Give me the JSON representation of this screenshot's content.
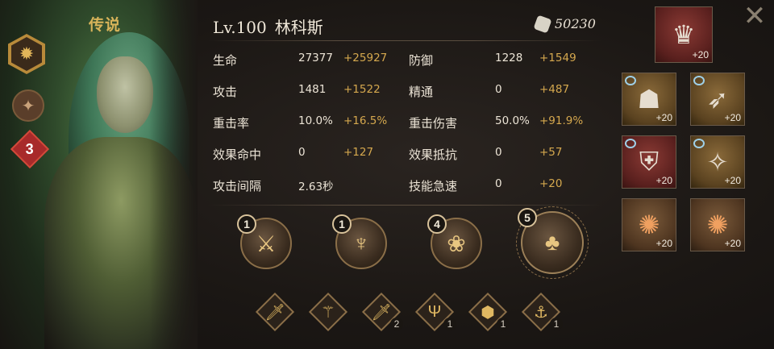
{
  "header": {
    "rarity": "传说",
    "level": "Lv.100",
    "name": "林科斯",
    "power": "50230"
  },
  "side_badges": [
    {
      "icon": "sun-star-icon"
    },
    {
      "icon": "compass-icon"
    },
    {
      "icon": "diamond-number-icon",
      "value": "3"
    }
  ],
  "stats": {
    "rows": [
      {
        "left": {
          "label": "生命",
          "value": "27377",
          "bonus": "+25927"
        },
        "right": {
          "label": "防御",
          "value": "1228",
          "bonus": "+1549"
        }
      },
      {
        "left": {
          "label": "攻击",
          "value": "1481",
          "bonus": "+1522"
        },
        "right": {
          "label": "精通",
          "value": "0",
          "bonus": "+487"
        }
      },
      {
        "left": {
          "label": "重击率",
          "value": "10.0%",
          "bonus": "+16.5%"
        },
        "right": {
          "label": "重击伤害",
          "value": "50.0%",
          "bonus": "+91.9%"
        }
      },
      {
        "left": {
          "label": "效果命中",
          "value": "0",
          "bonus": "+127"
        },
        "right": {
          "label": "效果抵抗",
          "value": "0",
          "bonus": "+57"
        }
      },
      {
        "left": {
          "label": "攻击间隔",
          "value": "2.63秒",
          "bonus": ""
        },
        "right": {
          "label": "技能急速",
          "value": "0",
          "bonus": "+20"
        }
      }
    ]
  },
  "skills": [
    {
      "level": "1",
      "icon": "crossed-swords-icon"
    },
    {
      "level": "1",
      "icon": "druid-figure-icon"
    },
    {
      "level": "4",
      "icon": "flower-orb-icon"
    },
    {
      "level": "5",
      "icon": "forest-spirit-icon"
    }
  ],
  "runes": [
    {
      "icon": "sword-icon",
      "count": ""
    },
    {
      "icon": "sword-pedestal-icon",
      "count": ""
    },
    {
      "icon": "sword-icon",
      "count": "2"
    },
    {
      "icon": "trident-icon",
      "count": "1"
    },
    {
      "icon": "shield-emblem-icon",
      "count": "1"
    },
    {
      "icon": "anchor-icon",
      "count": "1"
    }
  ],
  "equipment": [
    {
      "slot": "crown",
      "plus": "+20",
      "icon": "golden-crown-icon",
      "rarity": "red"
    },
    {
      "slot": "cloak",
      "plus": "+20",
      "icon": "dark-cloak-icon",
      "rarity": "gold"
    },
    {
      "slot": "spear",
      "plus": "+20",
      "icon": "ice-spear-icon",
      "rarity": "gold"
    },
    {
      "slot": "armor",
      "plus": "+20",
      "icon": "dark-armor-icon",
      "rarity": "red"
    },
    {
      "slot": "gauntlet",
      "plus": "+20",
      "icon": "crystal-gauntlet-icon",
      "rarity": "gold"
    },
    {
      "slot": "gem-1",
      "plus": "+20",
      "icon": "fire-gem-icon",
      "rarity": "warm"
    },
    {
      "slot": "gem-2",
      "plus": "+20",
      "icon": "fire-gem-icon",
      "rarity": "warm"
    }
  ],
  "colors": {
    "accent_gold": "#d5a84e",
    "text": "#ece4d6",
    "background": "#1c1815",
    "rarity_red": "#8a3a34"
  }
}
